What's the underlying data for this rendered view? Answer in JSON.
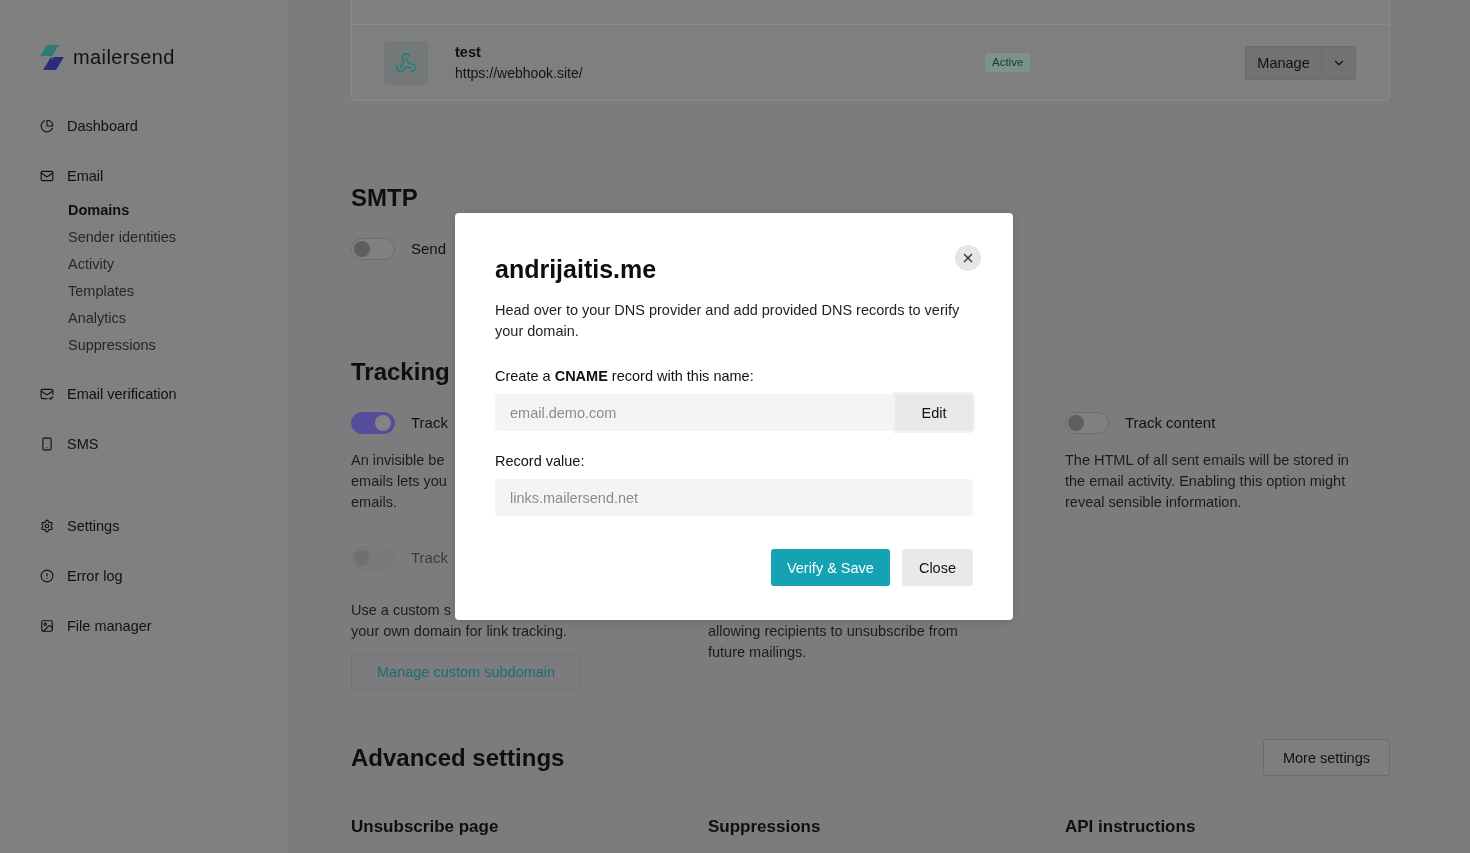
{
  "sidebar": {
    "brand": "mailersend",
    "nav": [
      {
        "label": "Dashboard",
        "selected": false
      },
      {
        "label": "Email",
        "selected": false,
        "children": [
          {
            "label": "Domains",
            "selected": true
          },
          {
            "label": "Sender identities",
            "selected": false
          },
          {
            "label": "Activity",
            "selected": false
          },
          {
            "label": "Templates",
            "selected": false
          },
          {
            "label": "Analytics",
            "selected": false
          },
          {
            "label": "Suppressions",
            "selected": false
          }
        ]
      },
      {
        "label": "Email verification",
        "selected": false
      },
      {
        "label": "SMS",
        "selected": false
      }
    ],
    "bottom_nav": [
      {
        "label": "Settings",
        "selected": false
      },
      {
        "label": "Error log",
        "selected": false
      },
      {
        "label": "File manager",
        "selected": false
      }
    ]
  },
  "webhooks": {
    "rows": [
      {
        "name": "test",
        "url": "https://webhook.site/",
        "status": "Active",
        "action": "Manage"
      }
    ]
  },
  "smtp": {
    "title": "SMTP",
    "toggle": {
      "label": "Send",
      "on": false
    }
  },
  "tracking": {
    "title": "Tracking",
    "columns": [
      {
        "options": [
          {
            "kind": "toggle",
            "label": "Track",
            "on": true,
            "disabled": false,
            "description_lines": [
              "An invisible be",
              "emails lets you",
              "emails."
            ]
          },
          {
            "kind": "toggle",
            "label": "Track",
            "on": false,
            "disabled": true,
            "description_lines": [
              "Use a custom s",
              "your own domain for link tracking."
            ],
            "button": "Manage custom subdomain"
          }
        ]
      },
      {
        "options": [
          {
            "kind": "fragment",
            "description_lines": [
              "allowing recipients to unsubscribe from",
              "future mailings."
            ]
          }
        ]
      },
      {
        "options": [
          {
            "kind": "toggle",
            "label": "Track content",
            "on": false,
            "disabled": false,
            "description": "The HTML of all sent emails will be stored in the email activity. Enabling this option might reveal sensible information."
          }
        ]
      }
    ]
  },
  "advanced": {
    "title": "Advanced settings",
    "button": "More settings",
    "sections": [
      "Unsubscribe page",
      "Suppressions",
      "API instructions"
    ]
  },
  "modal": {
    "title": "andrijaitis.me",
    "description": "Head over to your DNS provider and add provided DNS records to verify your domain.",
    "fields": [
      {
        "label": "Create a **CNAME** record with this name:",
        "value": "email.demo.com",
        "disabled": true,
        "button": "Edit"
      },
      {
        "label": "Record value:",
        "value": "links.mailersend.net",
        "disabled": true
      }
    ],
    "buttons": [
      {
        "label": "Verify & Save",
        "kind": "primary"
      },
      {
        "label": "Close",
        "kind": "secondary"
      }
    ]
  }
}
